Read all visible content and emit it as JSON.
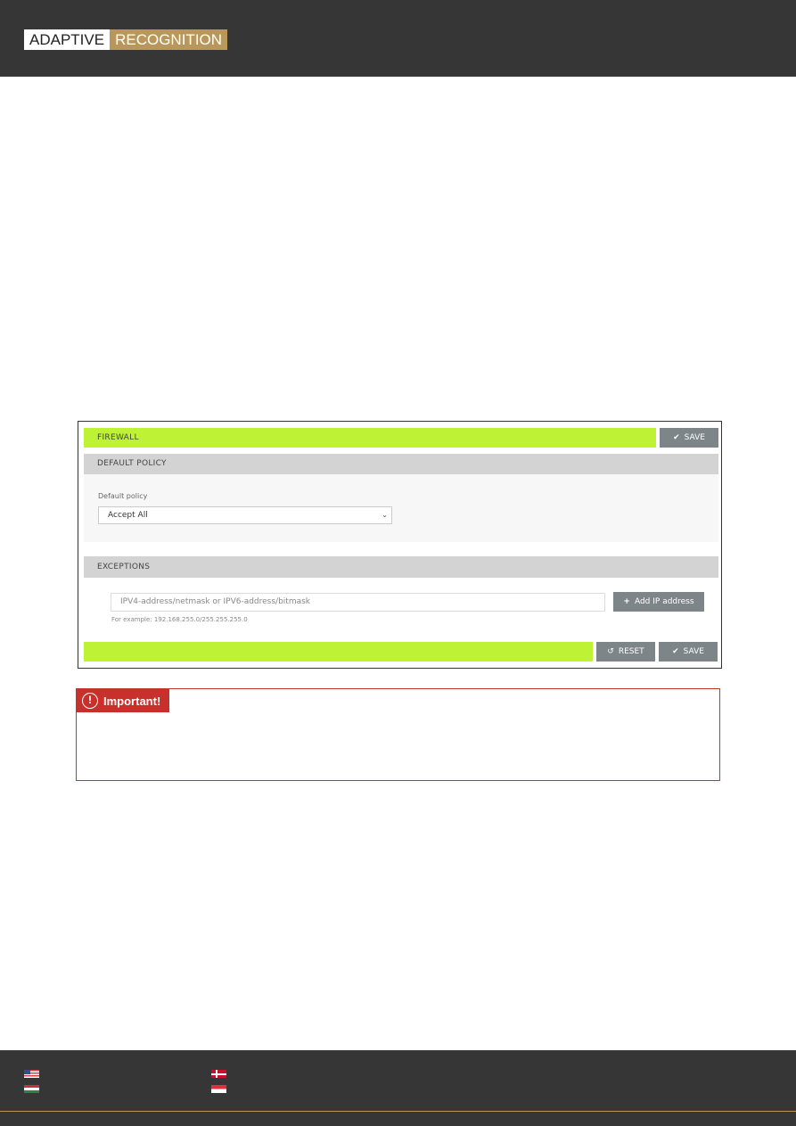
{
  "header": {
    "logo_left": "ADAPTIVE",
    "logo_right": "RECOGNITION"
  },
  "firewall": {
    "title": "FIREWALL",
    "save_label": "SAVE",
    "default_policy_section": "DEFAULT POLICY",
    "default_policy_label": "Default policy",
    "default_policy_value": "Accept All",
    "exceptions_section": "EXCEPTIONS",
    "ip_placeholder": "IPV4-address/netmask or IPV6-address/bitmask",
    "add_ip_label": "Add IP address",
    "example_hint": "For example: 192.168.255.0/255.255.255.0",
    "reset_label": "RESET",
    "accent_color": "#bdf235"
  },
  "important": {
    "label": "Important!",
    "color": "#c8302b"
  },
  "footer": {
    "flags": [
      "us-flag",
      "denmark-flag",
      "hungary-flag",
      "singapore-flag"
    ]
  }
}
